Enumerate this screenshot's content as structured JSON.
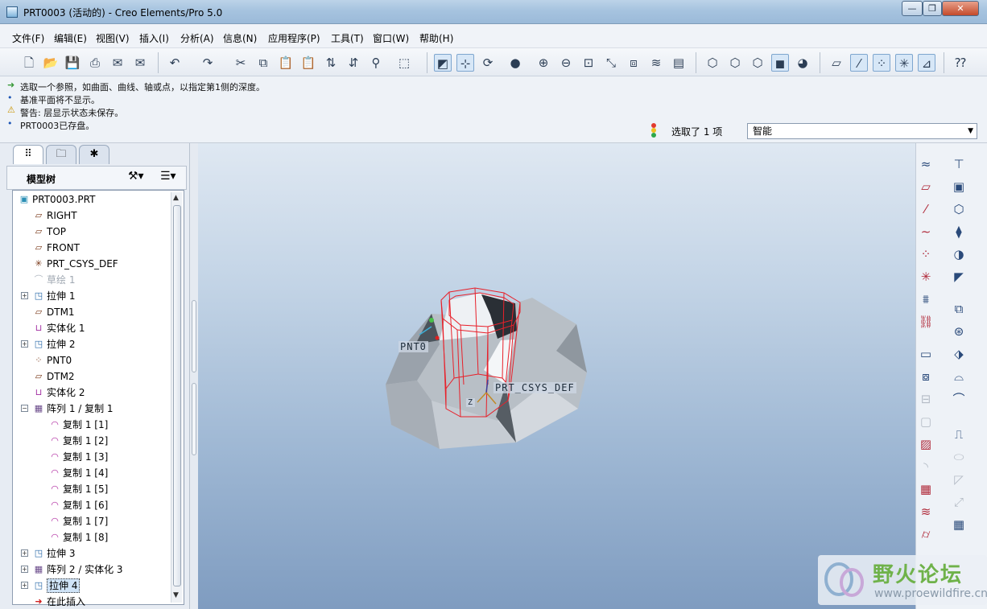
{
  "window": {
    "title": "PRT0003 (活动的) - Creo Elements/Pro 5.0",
    "min": "—",
    "max": "❐",
    "close": "✕"
  },
  "menu": [
    "文件(F)",
    "编辑(E)",
    "视图(V)",
    "插入(I)",
    "分析(A)",
    "信息(N)",
    "应用程序(P)",
    "工具(T)",
    "窗口(W)",
    "帮助(H)"
  ],
  "messages": [
    {
      "icon": "➜",
      "text": "选取一个参照，如曲面、曲线、轴或点，以指定第1侧的深度。"
    },
    {
      "icon": "•",
      "text": "基准平面将不显示。"
    },
    {
      "icon": "⚠",
      "text": "警告: 层显示状态未保存。"
    },
    {
      "icon": "•",
      "text": "PRT0003已存盘。"
    }
  ],
  "status": {
    "selected": "选取了  1 项",
    "filter": "智能"
  },
  "model_tree": {
    "title": "模型树",
    "items": [
      {
        "label": "PRT0003.PRT",
        "icon": "part-icon"
      },
      {
        "label": "RIGHT",
        "icon": "datum-plane-icon"
      },
      {
        "label": "TOP",
        "icon": "datum-plane-icon"
      },
      {
        "label": "FRONT",
        "icon": "datum-plane-icon"
      },
      {
        "label": "PRT_CSYS_DEF",
        "icon": "csys-icon"
      },
      {
        "label": "草绘 1",
        "icon": "sketch-icon"
      },
      {
        "label": "拉伸 1",
        "icon": "extrude-icon"
      },
      {
        "label": "DTM1",
        "icon": "datum-plane-icon"
      },
      {
        "label": "实体化 1",
        "icon": "solidify-icon"
      },
      {
        "label": "拉伸 2",
        "icon": "extrude-icon"
      },
      {
        "label": "PNT0",
        "icon": "datum-point-icon"
      },
      {
        "label": "DTM2",
        "icon": "datum-plane-icon"
      },
      {
        "label": "实体化 2",
        "icon": "solidify-icon"
      },
      {
        "label": "阵列 1 / 复制 1",
        "icon": "pattern-icon"
      },
      {
        "label": "复制 1 [1]",
        "icon": "copy-icon"
      },
      {
        "label": "复制 1 [2]",
        "icon": "copy-icon"
      },
      {
        "label": "复制 1 [3]",
        "icon": "copy-icon"
      },
      {
        "label": "复制 1 [4]",
        "icon": "copy-icon"
      },
      {
        "label": "复制 1 [5]",
        "icon": "copy-icon"
      },
      {
        "label": "复制 1 [6]",
        "icon": "copy-icon"
      },
      {
        "label": "复制 1 [7]",
        "icon": "copy-icon"
      },
      {
        "label": "复制 1 [8]",
        "icon": "copy-icon"
      },
      {
        "label": "拉伸 3",
        "icon": "extrude-icon"
      },
      {
        "label": "阵列 2 / 实体化 3",
        "icon": "pattern-icon"
      },
      {
        "label": "拉伸 4",
        "icon": "extrude-icon"
      },
      {
        "label": "在此插入",
        "icon": "insert-here-icon"
      }
    ]
  },
  "viewport": {
    "label_point": "PNT0",
    "label_csys": "PRT_CSYS_DEF",
    "axis_label": "Z"
  },
  "watermark": {
    "cn": "野火论坛",
    "en": "www.proewildfire.cn"
  },
  "colors": {
    "highlight_edge": "#e8202a",
    "model_face": "#b8bfc6",
    "viewport_top": "#dfe8f2",
    "viewport_bottom": "#7f9cc0"
  }
}
